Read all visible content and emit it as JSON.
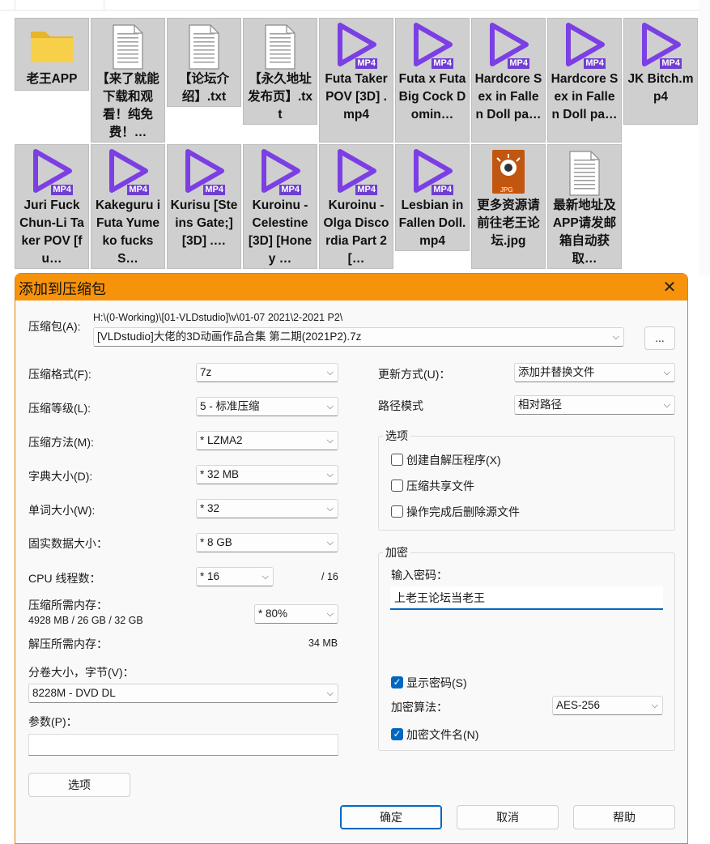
{
  "explorer": {
    "tiles": [
      {
        "name": "老王APP",
        "type": "folder"
      },
      {
        "name": "【来了就能下载和观看！纯免费！…",
        "type": "txt"
      },
      {
        "name": "【论坛介绍】.txt",
        "type": "txt"
      },
      {
        "name": "【永久地址发布页】.txt",
        "type": "txt"
      },
      {
        "name": "Futa Taker POV [3D] .mp4",
        "type": "mp4"
      },
      {
        "name": "Futa x Futa Big Cock Domin…",
        "type": "mp4"
      },
      {
        "name": "Hardcore Sex in Fallen Doll pa…",
        "type": "mp4"
      },
      {
        "name": "Hardcore Sex in Fallen Doll pa…",
        "type": "mp4"
      },
      {
        "name": "JK Bitch.mp4",
        "type": "mp4"
      },
      {
        "name": "Juri Fuck Chun-Li Taker POV [fu…",
        "type": "mp4"
      },
      {
        "name": "Kakeguru i Futa Yumeko fucks S…",
        "type": "mp4"
      },
      {
        "name": "Kurisu [Steins Gate;] [3D] .…",
        "type": "mp4"
      },
      {
        "name": "Kuroinu - Celestine [3D] [Honey …",
        "type": "mp4"
      },
      {
        "name": "Kuroinu - Olga Discordia Part 2 […",
        "type": "mp4"
      },
      {
        "name": "Lesbian in Fallen Doll.mp4",
        "type": "mp4"
      },
      {
        "name": "更多资源请前往老王论坛.jpg",
        "type": "jpg"
      },
      {
        "name": "最新地址及APP请发邮箱自动获取…",
        "type": "txt"
      }
    ],
    "mp4_badge": "MP4",
    "jpg_badge": "JPG"
  },
  "dialog": {
    "title": "添加到压缩包",
    "close_glyph": "✕",
    "archive_label": "压缩包(A):",
    "archive_path": "H:\\(0-Working)\\[01-VLDstudio]\\v\\01-07 2021\\2-2021 P2\\",
    "archive_name": "[VLDstudio]大佬的3D动画作品合集 第二期(2021P2).7z",
    "browse_label": "...",
    "left": {
      "format_label": "压缩格式(F):",
      "format_value": "7z",
      "level_label": "压缩等级(L):",
      "level_value": "5 - 标准压缩",
      "method_label": "压缩方法(M):",
      "method_value": "* LZMA2",
      "dict_label": "字典大小(D):",
      "dict_value": "* 32 MB",
      "word_label": "单词大小(W):",
      "word_value": "* 32",
      "solid_label": "固实数据大小：",
      "solid_value": "* 8 GB",
      "cpu_label": "CPU 线程数：",
      "cpu_value": "* 16",
      "cpu_max": "/ 16",
      "mem_label": "压缩所需内存：",
      "mem_detail": "4928 MB / 26 GB / 32 GB",
      "mem_value": "* 80%",
      "decomp_label": "解压所需内存：",
      "decomp_value": "34 MB",
      "volume_label": "分卷大小，字节(V)：",
      "volume_value": "8228M - DVD DL",
      "params_label": "参数(P)：",
      "options_button": "选项"
    },
    "right": {
      "update_label": "更新方式(U)：",
      "update_value": "添加并替换文件",
      "path_label": "路径模式",
      "path_value": "相对路径",
      "options_group": "选项",
      "opt_sfx": "创建自解压程序(X)",
      "opt_shared": "压缩共享文件",
      "opt_delete": "操作完成后删除源文件",
      "encrypt_group": "加密",
      "password_label": "输入密码：",
      "password_value": "上老王论坛当老王",
      "show_password": "显示密码(S)",
      "enc_method_label": "加密算法：",
      "enc_method_value": "AES-256",
      "encrypt_names": "加密文件名(N)",
      "check_glyph": "✓"
    },
    "ok_button": "确定",
    "cancel_button": "取消",
    "help_button": "帮助",
    "dropdown_glyph": "⌵"
  },
  "colors": {
    "accent": "#0067c0",
    "title_bar": "#f7930a",
    "mp4_icon": "#7b3fe4",
    "tile_bg": "#cfcfcf"
  }
}
